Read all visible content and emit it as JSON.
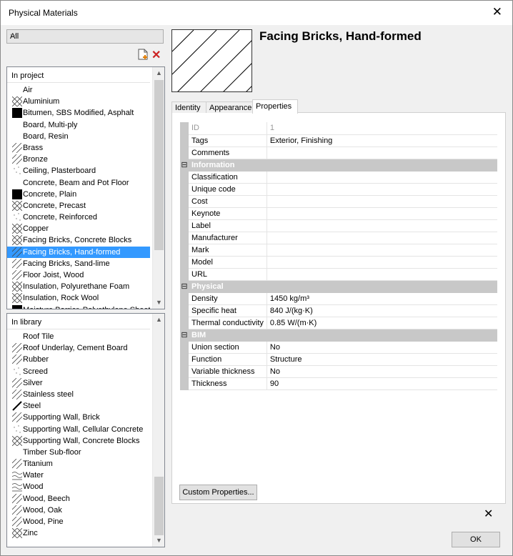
{
  "window": {
    "title": "Physical Materials",
    "close_icon": "close-icon"
  },
  "filter": {
    "selected": "All"
  },
  "toolbar": {
    "new_icon": "new-document-icon",
    "delete_icon": "delete-icon",
    "delete_color": "#cc2222"
  },
  "in_project": {
    "header": "In project",
    "items": [
      {
        "label": "Air",
        "swatch": "none"
      },
      {
        "label": "Aluminium",
        "swatch": "cross"
      },
      {
        "label": "Bitumen, SBS Modified, Asphalt",
        "swatch": "solid"
      },
      {
        "label": "Board, Multi-ply",
        "swatch": "none"
      },
      {
        "label": "Board, Resin",
        "swatch": "none"
      },
      {
        "label": "Brass",
        "swatch": "diag"
      },
      {
        "label": "Bronze",
        "swatch": "diag"
      },
      {
        "label": "Ceiling, Plasterboard",
        "swatch": "dots"
      },
      {
        "label": "Concrete, Beam and Pot Floor",
        "swatch": "none"
      },
      {
        "label": "Concrete, Plain",
        "swatch": "solid"
      },
      {
        "label": "Concrete, Precast",
        "swatch": "cross"
      },
      {
        "label": "Concrete, Reinforced",
        "swatch": "dots"
      },
      {
        "label": "Copper",
        "swatch": "cross"
      },
      {
        "label": "Facing Bricks, Concrete Blocks",
        "swatch": "cross"
      },
      {
        "label": "Facing Bricks, Hand-formed",
        "swatch": "diag",
        "selected": true
      },
      {
        "label": "Facing Bricks, Sand-lime",
        "swatch": "diag"
      },
      {
        "label": "Floor Joist, Wood",
        "swatch": "diag"
      },
      {
        "label": "Insulation, Polyurethane Foam",
        "swatch": "cross"
      },
      {
        "label": "Insulation, Rock Wool",
        "swatch": "cross"
      },
      {
        "label": "Moisture Barrier, Polyethylene Sheet",
        "swatch": "solid"
      }
    ]
  },
  "in_library": {
    "header": "In library",
    "items": [
      {
        "label": "Roof Tile",
        "swatch": "none"
      },
      {
        "label": "Roof Underlay, Cement Board",
        "swatch": "diag"
      },
      {
        "label": "Rubber",
        "swatch": "diag"
      },
      {
        "label": "Screed",
        "swatch": "dots"
      },
      {
        "label": "Silver",
        "swatch": "diag"
      },
      {
        "label": "Stainless steel",
        "swatch": "diag"
      },
      {
        "label": "Steel",
        "swatch": "bold"
      },
      {
        "label": "Supporting Wall, Brick",
        "swatch": "diag"
      },
      {
        "label": "Supporting Wall, Cellular Concrete",
        "swatch": "dots"
      },
      {
        "label": "Supporting Wall, Concrete Blocks",
        "swatch": "cross"
      },
      {
        "label": "Timber Sub-floor",
        "swatch": "none"
      },
      {
        "label": "Titanium",
        "swatch": "diag"
      },
      {
        "label": "Water",
        "swatch": "wave"
      },
      {
        "label": "Wood",
        "swatch": "wave"
      },
      {
        "label": "Wood, Beech",
        "swatch": "diag"
      },
      {
        "label": "Wood, Oak",
        "swatch": "diag"
      },
      {
        "label": "Wood, Pine",
        "swatch": "diag"
      },
      {
        "label": "Zinc",
        "swatch": "cross"
      }
    ]
  },
  "material": {
    "title": "Facing Bricks, Hand-formed",
    "preview_pattern": "diagonal-hatch"
  },
  "tabs": [
    "Identity",
    "Appearance",
    "Properties"
  ],
  "active_tab": "Properties",
  "properties": [
    {
      "key": "ID",
      "value": "1",
      "dim": true
    },
    {
      "key": "Tags",
      "value": "Exterior, Finishing"
    },
    {
      "key": "Comments",
      "value": ""
    },
    {
      "category": "Information"
    },
    {
      "key": "Classification",
      "value": ""
    },
    {
      "key": "Unique code",
      "value": ""
    },
    {
      "key": "Cost",
      "value": ""
    },
    {
      "key": "Keynote",
      "value": ""
    },
    {
      "key": "Label",
      "value": ""
    },
    {
      "key": "Manufacturer",
      "value": ""
    },
    {
      "key": "Mark",
      "value": ""
    },
    {
      "key": "Model",
      "value": ""
    },
    {
      "key": "URL",
      "value": ""
    },
    {
      "category": "Physical"
    },
    {
      "key": "Density",
      "value": "1450 kg/m³"
    },
    {
      "key": "Specific heat",
      "value": "840 J/(kg·K)"
    },
    {
      "key": "Thermal conductivity",
      "value": "0.85 W/(m·K)"
    },
    {
      "category": "BIM"
    },
    {
      "key": "Union section",
      "value": "No"
    },
    {
      "key": "Function",
      "value": "Structure"
    },
    {
      "key": "Variable thickness",
      "value": "No"
    },
    {
      "key": "Thickness",
      "value": "90"
    }
  ],
  "buttons": {
    "custom": "Custom Properties...",
    "ok": "OK"
  },
  "collapse_glyph": "⊟"
}
